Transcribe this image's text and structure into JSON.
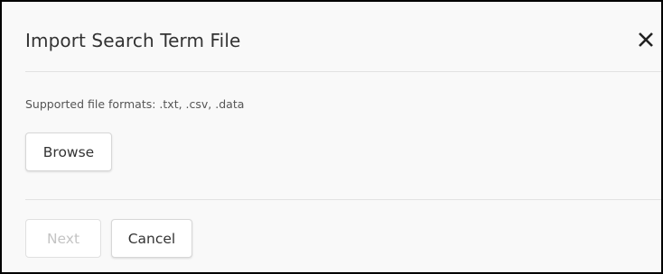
{
  "dialog": {
    "title": "Import Search Term File",
    "close_icon": "close-icon",
    "formats_text": "Supported file formats: .txt, .csv, .data",
    "browse_label": "Browse",
    "next_label": "Next",
    "next_disabled": true,
    "cancel_label": "Cancel"
  },
  "colors": {
    "background": "#f9f9f9",
    "border": "#000000",
    "title_text": "#333333",
    "muted_text": "#555555",
    "disabled_text": "#c4c4c4",
    "divider": "#e2e2e2"
  }
}
